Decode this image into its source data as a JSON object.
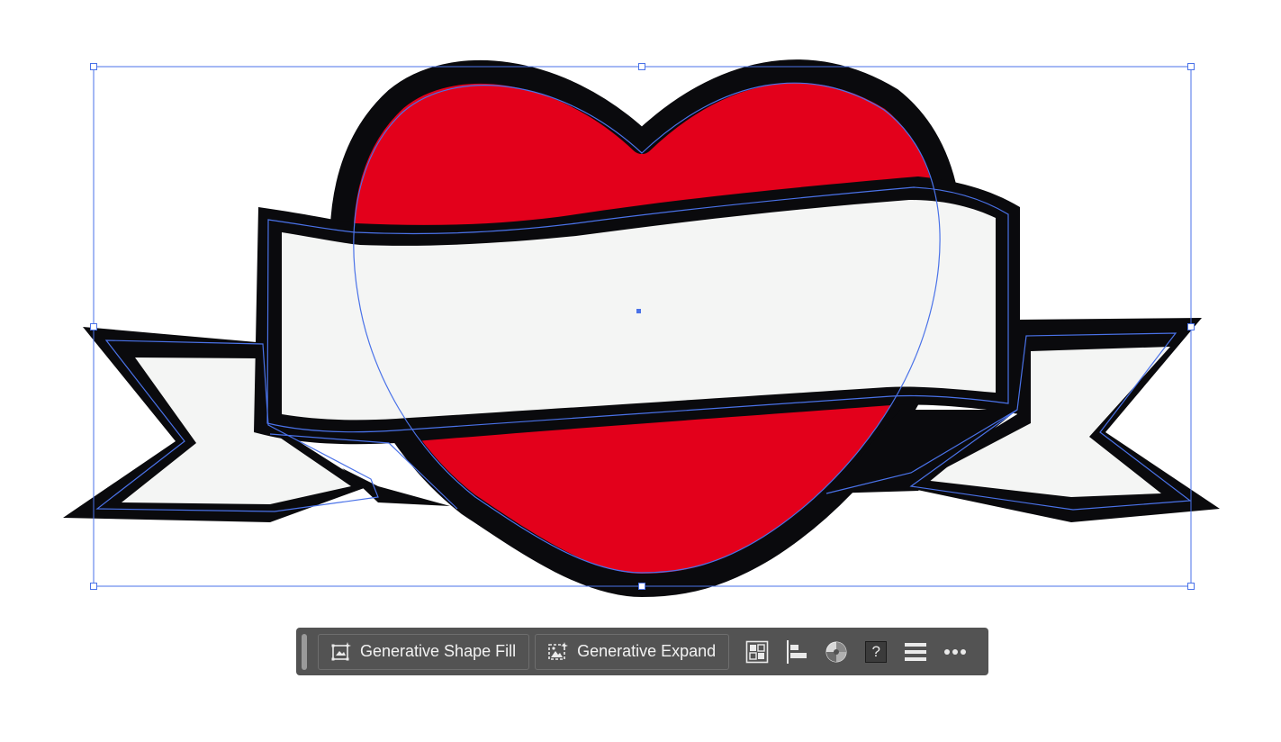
{
  "artwork": {
    "colors": {
      "heart_fill": "#e3001b",
      "outline": "#0a0a0d",
      "banner_fill": "#f4f5f4",
      "selection": "#4a72e8"
    }
  },
  "context_bar": {
    "generative_shape_fill_label": "Generative Shape Fill",
    "generative_expand_label": "Generative Expand",
    "help_label": "?",
    "icons": [
      "generative-shape-fill-icon",
      "generative-expand-icon",
      "arrange-icon",
      "align-icon",
      "recolor-icon",
      "help-icon",
      "menu-icon",
      "more-icon"
    ]
  }
}
